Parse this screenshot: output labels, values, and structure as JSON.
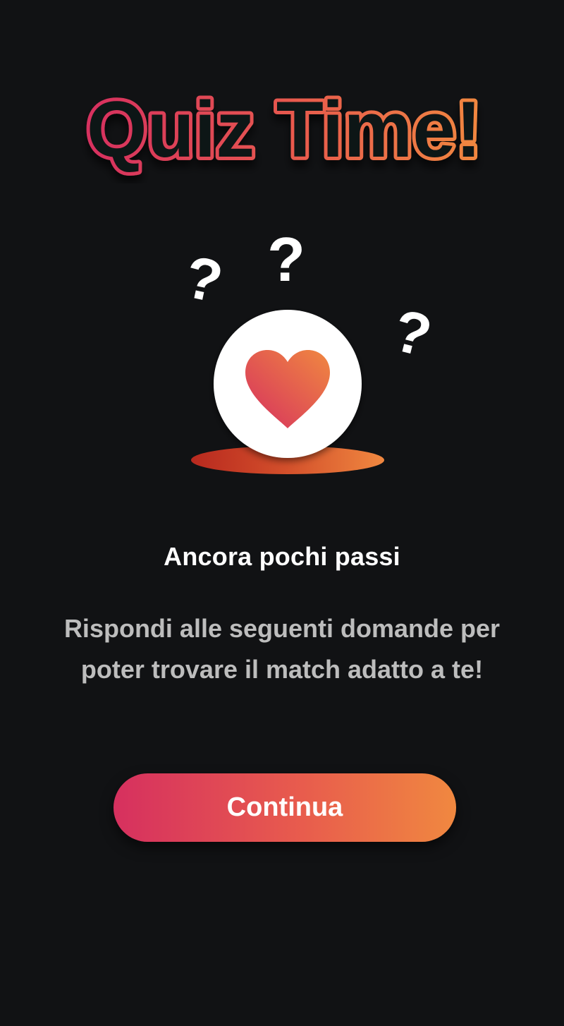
{
  "header": {
    "title": "Quiz Time!"
  },
  "illustration": {
    "icon": "heart-icon",
    "decorations": [
      "question-mark-icon",
      "question-mark-icon",
      "question-mark-icon"
    ],
    "colors": {
      "gradient_start": "#d6305f",
      "gradient_end": "#f08840",
      "circle": "#ffffff"
    }
  },
  "content": {
    "subtitle": "Ancora pochi passi",
    "description": "Rispondi alle seguenti domande per poter trovare il match adatto a te!"
  },
  "actions": {
    "continue_label": "Continua"
  },
  "theme": {
    "background": "#111214",
    "text_primary": "#ffffff",
    "text_secondary": "#bdbdbd"
  }
}
